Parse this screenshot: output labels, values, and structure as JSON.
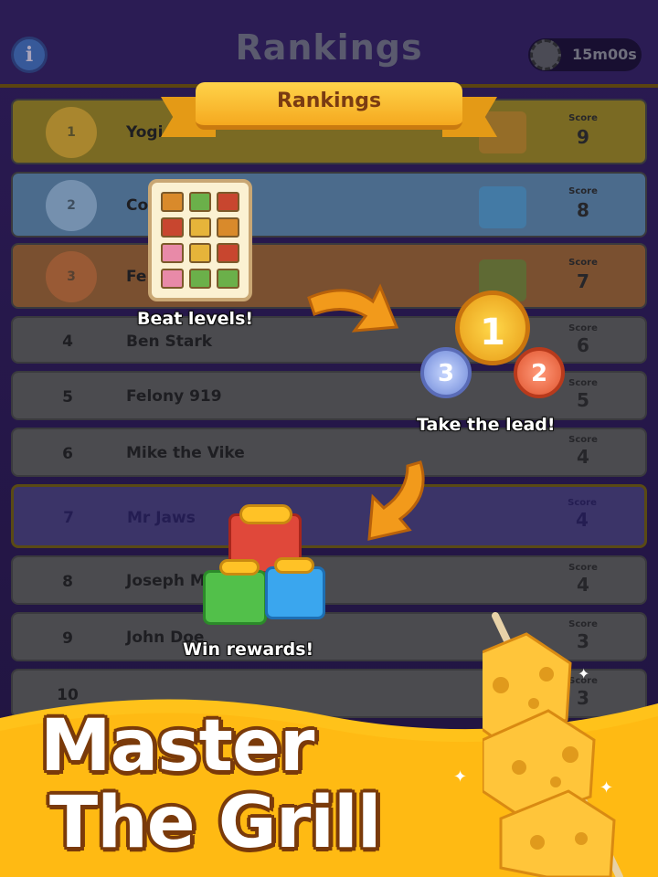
{
  "header": {
    "title": "Rankings",
    "info_label": "i",
    "timer": "15m00s"
  },
  "ribbon": {
    "label": "Rankings"
  },
  "rows": [
    {
      "rank": "1",
      "name": "Yogi",
      "score_label": "Score",
      "score": "9",
      "tier": "gold"
    },
    {
      "rank": "2",
      "name": "Co",
      "score_label": "Score",
      "score": "8",
      "tier": "silver"
    },
    {
      "rank": "3",
      "name": "Fe",
      "score_label": "Score",
      "score": "7",
      "tier": "bronze"
    },
    {
      "rank": "4",
      "name": "Ben Stark",
      "score_label": "Score",
      "score": "6"
    },
    {
      "rank": "5",
      "name": "Felony 919",
      "score_label": "Score",
      "score": "5"
    },
    {
      "rank": "6",
      "name": "Mike the Vike",
      "score_label": "Score",
      "score": "4"
    },
    {
      "rank": "7",
      "name": "Mr Jaws",
      "score_label": "Score",
      "score": "4",
      "highlight": true
    },
    {
      "rank": "8",
      "name": "Joseph M",
      "score_label": "Score",
      "score": "4"
    },
    {
      "rank": "9",
      "name": "John Doe",
      "score_label": "Score",
      "score": "3"
    },
    {
      "rank": "10",
      "name": "",
      "score_label": "Score",
      "score": "3"
    }
  ],
  "tutorial": {
    "step1": "Beat levels!",
    "step2": "Take the lead!",
    "step3": "Win rewards!",
    "medals": [
      "1",
      "2",
      "3"
    ]
  },
  "banner": {
    "line1": "Master",
    "line2": "The Grill"
  },
  "colors": {
    "accent_gold": "#f5a91f",
    "banner_yellow": "#ffc21a",
    "arrow_orange": "#f29a1b",
    "headline_outline": "#7a3a0a"
  },
  "icons": [
    "info-icon",
    "clock-icon",
    "medal-gold-icon",
    "medal-silver-icon",
    "medal-bronze-icon",
    "gift-icon",
    "arrow-icon",
    "cheese-skewer-icon",
    "sparkle-icon"
  ]
}
